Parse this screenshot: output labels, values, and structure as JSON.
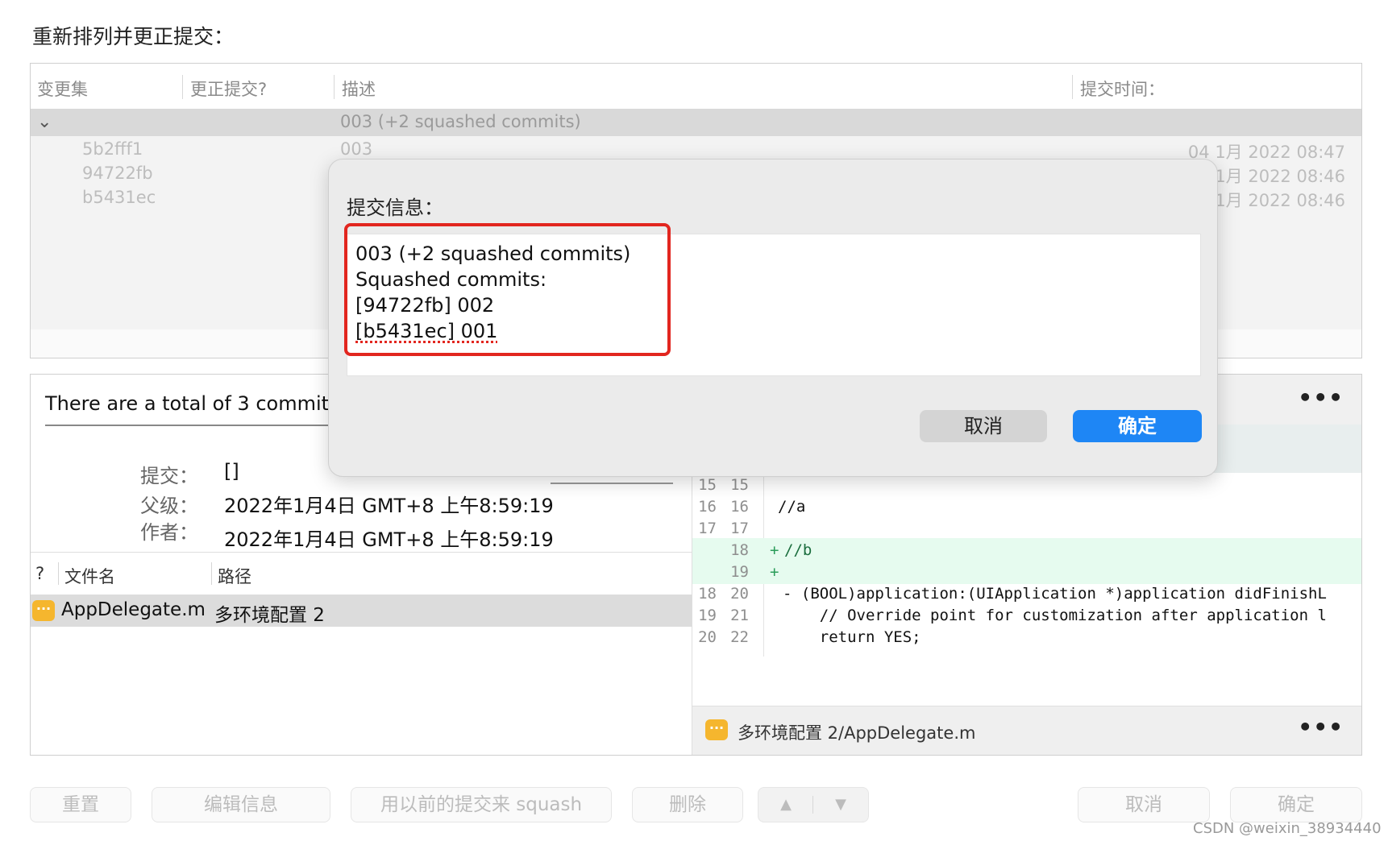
{
  "title": "重新排列并更正提交：",
  "commits_table": {
    "columns": [
      "变更集",
      "更正提交?",
      "描述",
      "提交时间："
    ],
    "group": {
      "description": "003 (+2 squashed commits)"
    },
    "rows": [
      {
        "changeset": "5b2fff1",
        "description": "003",
        "time": "04 1月 2022 08:47"
      },
      {
        "changeset": "94722fb",
        "description": "",
        "time": "1月 2022 08:46"
      },
      {
        "changeset": "b5431ec",
        "description": "",
        "time": "1月 2022 08:46"
      }
    ]
  },
  "details": {
    "summary": "There are a total of 3 commits",
    "commit_label": "提交：",
    "commit_value": "[]",
    "parent_label": "父级：",
    "parent_value": "2022年1月4日 GMT+8 上午8:59:19",
    "author_label": "作者：",
    "author_value": "2022年1月4日 GMT+8 上午8:59:19"
  },
  "files_table": {
    "columns": [
      "?",
      "文件名",
      "路径"
    ],
    "rows": [
      {
        "icon": "ellipsis-file-icon",
        "name": "AppDelegate.m",
        "path": "多环境配置 2"
      }
    ]
  },
  "diff": {
    "more": "•••",
    "lines": [
      {
        "old": "15",
        "new": "15",
        "sign": "",
        "code": "",
        "type": "context"
      },
      {
        "old": "16",
        "new": "16",
        "sign": "",
        "code": "//a",
        "type": "context"
      },
      {
        "old": "17",
        "new": "17",
        "sign": "",
        "code": "",
        "type": "context"
      },
      {
        "old": "",
        "new": "18",
        "sign": "+",
        "code": "//b",
        "type": "added"
      },
      {
        "old": "",
        "new": "19",
        "sign": "+",
        "code": "",
        "type": "added"
      },
      {
        "old": "18",
        "new": "20",
        "sign": "",
        "code": "- (BOOL)application:(UIApplication *)application didFinishL",
        "type": "context"
      },
      {
        "old": "19",
        "new": "21",
        "sign": "",
        "code": "    // Override point for customization after application l",
        "type": "context"
      },
      {
        "old": "20",
        "new": "22",
        "sign": "",
        "code": "    return YES;",
        "type": "context"
      }
    ],
    "footer_path": "多环境配置 2/AppDelegate.m",
    "footer_more": "•••"
  },
  "toolbar": {
    "reset": "重置",
    "edit_message": "编辑信息",
    "squash": "用以前的提交来 squash",
    "delete": "删除",
    "up": "▲",
    "down": "▼",
    "cancel": "取消",
    "ok": "确定"
  },
  "popover": {
    "label": "提交信息：",
    "message_lines": [
      "003 (+2 squashed commits)",
      "Squashed commits:",
      "[94722fb] 002",
      "[b5431ec] 001"
    ],
    "cancel": "取消",
    "ok": "确定"
  },
  "watermark": "CSDN @weixin_38934440",
  "colors": {
    "accent": "#1e86f5",
    "highlight": "#e2261f",
    "added_bg": "#e6fbef"
  }
}
